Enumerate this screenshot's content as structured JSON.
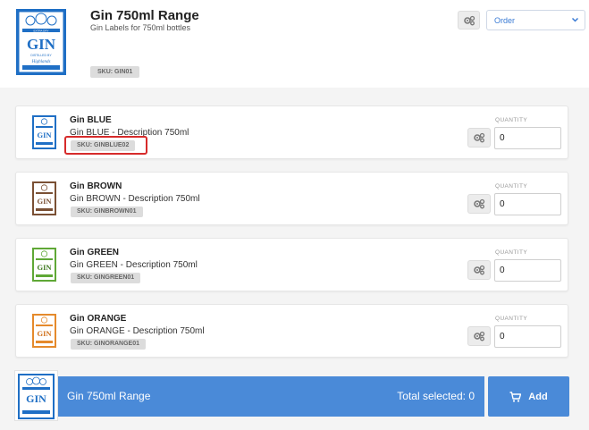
{
  "header": {
    "title": "Gin 750ml Range",
    "subtitle": "Gin Labels for 750ml bottles",
    "sku": "SKU: GIN01",
    "order_select": "Order",
    "thumb": {
      "top_text": "EXTRA DRY",
      "word": "GIN",
      "bottom_text": "DISTILLED BY",
      "script": "Highlands",
      "color": "#1f6fc5"
    }
  },
  "products": [
    {
      "name": "Gin BLUE",
      "description": "Gin BLUE - Description 750ml",
      "sku": "SKU: GINBLUE02",
      "quantity_label": "QUANTITY",
      "quantity": "0",
      "color": "#1f6fc5"
    },
    {
      "name": "Gin BROWN",
      "description": "Gin BROWN - Description 750ml",
      "sku": "SKU: GINBROWN01",
      "quantity_label": "QUANTITY",
      "quantity": "0",
      "color": "#7a5034"
    },
    {
      "name": "Gin GREEN",
      "description": "Gin GREEN - Description 750ml",
      "sku": "SKU: GINGREEN01",
      "quantity_label": "QUANTITY",
      "quantity": "0",
      "color": "#5fa836"
    },
    {
      "name": "Gin ORANGE",
      "description": "Gin ORANGE - Description 750ml",
      "sku": "SKU: GINORANGE01",
      "quantity_label": "QUANTITY",
      "quantity": "0",
      "color": "#e58a2c"
    }
  ],
  "footer": {
    "title": "Gin 750ml Range",
    "total": "Total selected: 0",
    "add_label": "Add"
  },
  "colors": {
    "accent": "#4a8ad8",
    "highlight": "#d62b2b"
  },
  "icons": {
    "settings": "gears-icon",
    "cart": "cart-icon",
    "dropdown": "chevron-down-icon"
  }
}
